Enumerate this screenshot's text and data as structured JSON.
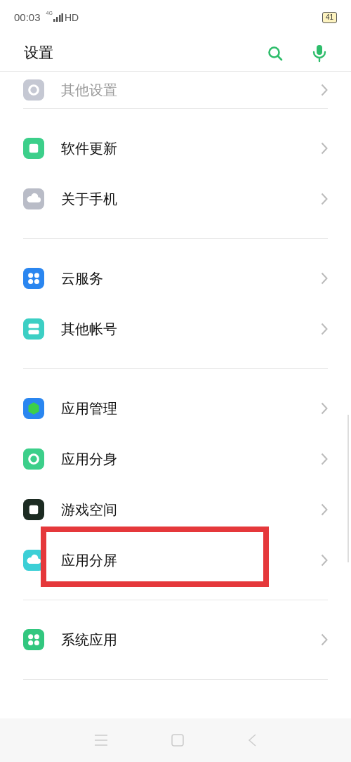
{
  "status_bar": {
    "time": "00:03",
    "network": "4G",
    "hd": "HD",
    "battery": "41"
  },
  "header": {
    "title": "设置"
  },
  "groups": [
    {
      "items": [
        {
          "label": "其他设置",
          "color": "#c5c8d3",
          "highlighted": false
        }
      ]
    },
    {
      "items": [
        {
          "label": "软件更新",
          "color": "#3ccf8a",
          "highlighted": false
        },
        {
          "label": "关于手机",
          "color": "#b9bcc7",
          "highlighted": false
        }
      ]
    },
    {
      "items": [
        {
          "label": "云服务",
          "color": "#2a86f0",
          "highlighted": false
        },
        {
          "label": "其他帐号",
          "color": "#3ccfc4",
          "highlighted": false
        }
      ]
    },
    {
      "items": [
        {
          "label": "应用管理",
          "color": "#2a86f0",
          "highlighted": false
        },
        {
          "label": "应用分身",
          "color": "#3ccf8a",
          "highlighted": false
        },
        {
          "label": "游戏空间",
          "color": "#1c2b22",
          "highlighted": false
        },
        {
          "label": "应用分屏",
          "color": "#3ccfd6",
          "highlighted": true
        }
      ]
    },
    {
      "items": [
        {
          "label": "系统应用",
          "color": "#32c77f",
          "highlighted": false
        }
      ]
    }
  ]
}
